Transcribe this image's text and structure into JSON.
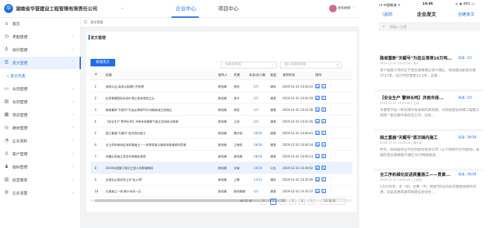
{
  "header": {
    "logo_text": "华",
    "company": "湖南省华营建设工程管理有限责任公司",
    "tabs": [
      "企业中心",
      "项目中心"
    ],
    "user": "欧阳娜娜"
  },
  "sidebar": {
    "items": [
      {
        "label": "首页",
        "icon": "⌂"
      },
      {
        "label": "考勤管理",
        "icon": "◷"
      },
      {
        "label": "用印管理",
        "icon": "♁"
      },
      {
        "label": "发文管理",
        "icon": "☰"
      },
      {
        "label": "发文列表",
        "icon": ""
      },
      {
        "label": "合同管理",
        "icon": "▭"
      },
      {
        "label": "合同管理",
        "icon": "▤"
      },
      {
        "label": "项目管理",
        "icon": "▦"
      },
      {
        "label": "绩效管理",
        "icon": "◎"
      },
      {
        "label": "企业资料",
        "icon": "◔"
      },
      {
        "label": "客户管理",
        "icon": "♙"
      },
      {
        "label": "投标管理",
        "icon": "♟"
      },
      {
        "label": "经营报表",
        "icon": "▥"
      },
      {
        "label": "企业设置",
        "icon": "⚙"
      }
    ]
  },
  "breadcrumb": "发文管理",
  "card": {
    "title": "发文管理",
    "new_button": "新建发文",
    "type_select": "按类型筛选",
    "search_placeholder": "输入标题来搜索"
  },
  "table": {
    "columns": [
      "#",
      "标题",
      "发件人",
      "作者",
      "未读/总人数",
      "类型",
      "发布时间",
      "操作"
    ],
    "rows": [
      {
        "n": "1",
        "title": "湖南元品.英液公园通行不收费",
        "sender": "欧阳娜",
        "author": "欧阳",
        "read": "5/5",
        "type": "通知",
        "time": "2019-12-31 14:42:41"
      },
      {
        "n": "2",
        "title": "红伊景属国际机场扩建工程本季前工元",
        "sender": "欧阳娜",
        "author": "青羊",
        "read": "1/1",
        "type": "通报",
        "time": "2019-12-31 14:42:19"
      },
      {
        "n": "3",
        "title": "路坡重新\"天赋号\"为连云港港10万吨级航道工程施工",
        "sender": "欧阳娜",
        "author": "杨蓝",
        "read": "1/1",
        "type": "通报",
        "time": "2019-12-31 14:41:58"
      },
      {
        "n": "4",
        "title": "【安全生产 警钟长鸣】济南市排要随气施工现场安全隐患",
        "sender": "欧阳娜",
        "author": "王泽",
        "read": "2/2",
        "type": "通报",
        "time": "2019-12-31 14:41:45"
      },
      {
        "n": "5",
        "title": "国之重器\"天鲲号\"首次国内施工",
        "sender": "欧阳娜",
        "author": "魏大勃",
        "read": "18/18",
        "type": "通报",
        "time": "2019-12-31 14:40:41"
      },
      {
        "n": "6",
        "title": "全工序机械化促进质量施工——贵黄高速公路首条隧道顺利贯通",
        "sender": "欧阳娜",
        "author": "王俯凯",
        "read": "18/18",
        "type": "通报",
        "time": "2019-12-31 14:40:24"
      },
      {
        "n": "7",
        "title": "东霸区再施工项目学隐患处理案",
        "sender": "欧阳娜",
        "author": "欧阳娜",
        "read": "18/18",
        "type": "通报",
        "time": "2019-12-31 14:40:13"
      },
      {
        "n": "8",
        "title": "2019年度属于我们工程人的荣誉瞬间",
        "sender": "欧阳娜",
        "author": "文颖",
        "read": "19/19",
        "type": "公告",
        "time": "2019-12-31 14:40:02"
      },
      {
        "n": "9",
        "title": "业绩无止境优势工作\"走心得\"",
        "sender": "欧阳娜",
        "author": "王霖",
        "read": "13/13",
        "type": "通知",
        "time": "2019-12-31 14:35:49"
      },
      {
        "n": "10",
        "title": "扎根施工一线 数十年如一日",
        "sender": "欧阳娜",
        "author": "欧阳娜娜",
        "read": "1/1",
        "type": "通报",
        "time": "2019-12-31 14:35:37"
      }
    ]
  },
  "pagination": {
    "total": "共 31 条",
    "prev": "<",
    "pages": [
      "1",
      "2",
      "3",
      "4"
    ],
    "current_page": "1",
    "next": ">",
    "page_size": "10 条/页"
  },
  "phone": {
    "status_left": "•ıl 中国联通 ᯤ",
    "status_time": "14:46",
    "status_right": "◎ ◉ 49% ▭",
    "back": "〈返回",
    "title": "企业发文",
    "create": "创建发文",
    "search_placeholder": "请输入主题",
    "items": [
      {
        "title": "路坡重新\"天鲲号\"为连云港港10万吨...",
        "read": "未读: 1/1",
        "meta": "2019-12-31 14:45:59 | 青羊",
        "summary": "该工程施工地点位于连云港港港区徐圩港区，规划建设航道长度3727米，设计开挖宽度13.3米，总疏..."
      },
      {
        "title": "【安全生产 警钟长鸣】济南市排...",
        "read": "未读: 2/2",
        "meta": "2019-12-31 14:45:46 | 王泽",
        "summary": "冬春季节是一氧化碳中毒事故的高发期。为加强建设领域工程施工现场一氧化碳中毒防范工作，切实..."
      },
      {
        "title": "国之重器\"天鲲号\"首次国内施工",
        "read": "未读: 18/18",
        "meta": "2019-12-31 14:40:26 | 魏大勃",
        "summary": "昨天，由挖掘央企中交天航局有限公司（以下简称中交天航局）承建的连云港港徐圩港区30万吨级航道..."
      },
      {
        "title": "全工序机械化促进质量施工——贵黄...",
        "read": "未读: 18/18",
        "meta": "2019-12-31 14:40:26 | 王俯凯",
        "summary": "12月28日，贵（阳）至黄（平）高速TJ9合同段龙盘隧道顺利贯通，这是贵黄高速项目建设全线全..."
      }
    ]
  },
  "colors": {
    "accent": "#1f6fe5",
    "highlight_row": "#e9f2fe"
  }
}
